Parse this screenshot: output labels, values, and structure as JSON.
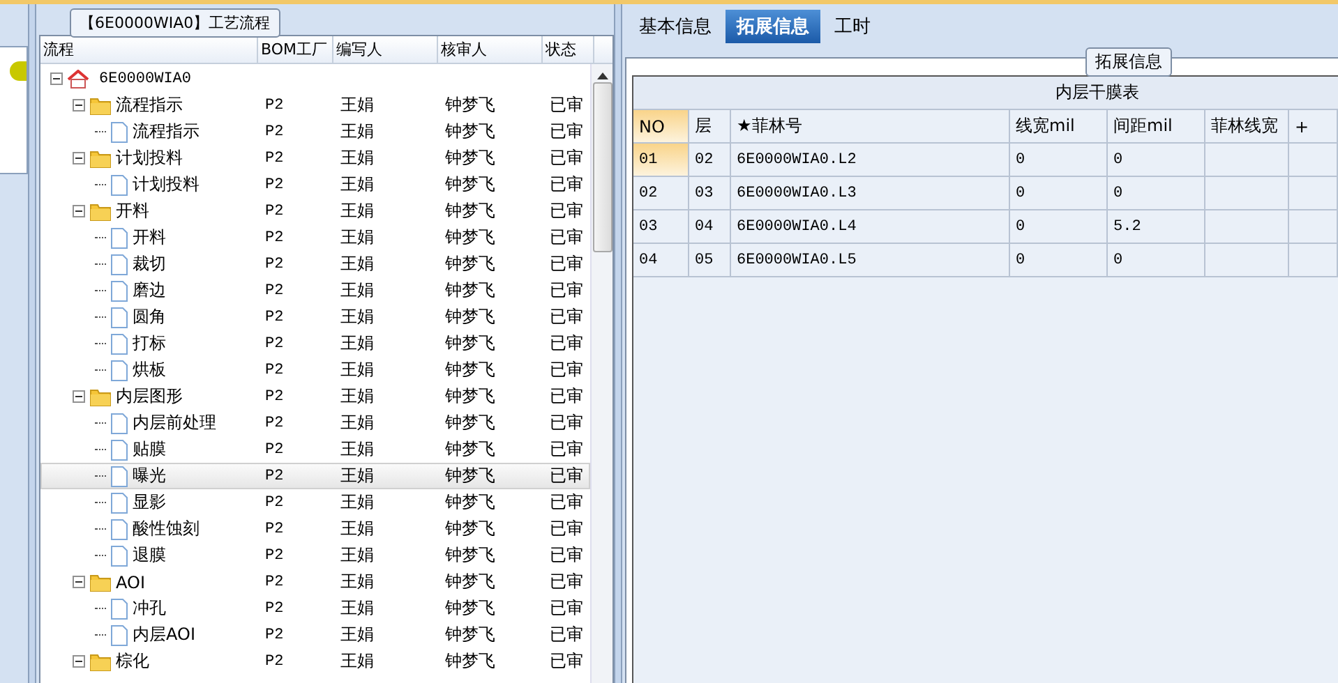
{
  "flow_panel": {
    "title": "【6E0000WIA0】工艺流程",
    "columns": [
      "流程",
      "BOM工厂",
      "编写人",
      "核审人",
      "状态"
    ],
    "tree": [
      {
        "kind": "root",
        "name": "6E0000WIA0",
        "selected": false,
        "expanded": true,
        "children": [
          {
            "kind": "folder",
            "name": "流程指示",
            "factory": "P2",
            "author": "王娟",
            "reviewer": "钟梦飞",
            "status": "已审",
            "selected": false,
            "expanded": true,
            "children": [
              {
                "kind": "doc",
                "name": "流程指示",
                "factory": "P2",
                "author": "王娟",
                "reviewer": "钟梦飞",
                "status": "已审",
                "selected": false
              }
            ]
          },
          {
            "kind": "folder",
            "name": "计划投料",
            "factory": "P2",
            "author": "王娟",
            "reviewer": "钟梦飞",
            "status": "已审",
            "selected": false,
            "expanded": true,
            "children": [
              {
                "kind": "doc",
                "name": "计划投料",
                "factory": "P2",
                "author": "王娟",
                "reviewer": "钟梦飞",
                "status": "已审",
                "selected": false
              }
            ]
          },
          {
            "kind": "folder",
            "name": "开料",
            "factory": "P2",
            "author": "王娟",
            "reviewer": "钟梦飞",
            "status": "已审",
            "selected": false,
            "expanded": true,
            "children": [
              {
                "kind": "doc",
                "name": "开料",
                "factory": "P2",
                "author": "王娟",
                "reviewer": "钟梦飞",
                "status": "已审",
                "selected": false
              },
              {
                "kind": "doc",
                "name": "裁切",
                "factory": "P2",
                "author": "王娟",
                "reviewer": "钟梦飞",
                "status": "已审",
                "selected": false
              },
              {
                "kind": "doc",
                "name": "磨边",
                "factory": "P2",
                "author": "王娟",
                "reviewer": "钟梦飞",
                "status": "已审",
                "selected": false
              },
              {
                "kind": "doc",
                "name": "圆角",
                "factory": "P2",
                "author": "王娟",
                "reviewer": "钟梦飞",
                "status": "已审",
                "selected": false
              },
              {
                "kind": "doc",
                "name": "打标",
                "factory": "P2",
                "author": "王娟",
                "reviewer": "钟梦飞",
                "status": "已审",
                "selected": false
              },
              {
                "kind": "doc",
                "name": "烘板",
                "factory": "P2",
                "author": "王娟",
                "reviewer": "钟梦飞",
                "status": "已审",
                "selected": false
              }
            ]
          },
          {
            "kind": "folder",
            "name": "内层图形",
            "factory": "P2",
            "author": "王娟",
            "reviewer": "钟梦飞",
            "status": "已审",
            "selected": false,
            "expanded": true,
            "children": [
              {
                "kind": "doc",
                "name": "内层前处理",
                "factory": "P2",
                "author": "王娟",
                "reviewer": "钟梦飞",
                "status": "已审",
                "selected": false
              },
              {
                "kind": "doc",
                "name": "贴膜",
                "factory": "P2",
                "author": "王娟",
                "reviewer": "钟梦飞",
                "status": "已审",
                "selected": false
              },
              {
                "kind": "doc",
                "name": "曝光",
                "factory": "P2",
                "author": "王娟",
                "reviewer": "钟梦飞",
                "status": "已审",
                "selected": true
              },
              {
                "kind": "doc",
                "name": "显影",
                "factory": "P2",
                "author": "王娟",
                "reviewer": "钟梦飞",
                "status": "已审",
                "selected": false
              },
              {
                "kind": "doc",
                "name": "酸性蚀刻",
                "factory": "P2",
                "author": "王娟",
                "reviewer": "钟梦飞",
                "status": "已审",
                "selected": false
              },
              {
                "kind": "doc",
                "name": "退膜",
                "factory": "P2",
                "author": "王娟",
                "reviewer": "钟梦飞",
                "status": "已审",
                "selected": false
              }
            ]
          },
          {
            "kind": "folder",
            "name": "AOI",
            "factory": "P2",
            "author": "王娟",
            "reviewer": "钟梦飞",
            "status": "已审",
            "selected": false,
            "expanded": true,
            "children": [
              {
                "kind": "doc",
                "name": "冲孔",
                "factory": "P2",
                "author": "王娟",
                "reviewer": "钟梦飞",
                "status": "已审",
                "selected": false
              },
              {
                "kind": "doc",
                "name": "内层AOI",
                "factory": "P2",
                "author": "王娟",
                "reviewer": "钟梦飞",
                "status": "已审",
                "selected": false
              }
            ]
          },
          {
            "kind": "folder",
            "name": "棕化",
            "factory": "P2",
            "author": "王娟",
            "reviewer": "钟梦飞",
            "status": "已审",
            "selected": false,
            "expanded": true
          }
        ]
      }
    ]
  },
  "tabs": [
    {
      "label": "基本信息",
      "selected": false
    },
    {
      "label": "拓展信息",
      "selected": true
    },
    {
      "label": "工时",
      "selected": false
    }
  ],
  "ext_panel": {
    "title": "拓展信息",
    "table": {
      "title": "内层干膜表",
      "columns": [
        "NO",
        "层",
        "★菲林号",
        "线宽mil",
        "间距mil",
        "菲林线宽",
        "+"
      ],
      "rows": [
        {
          "selected": true,
          "cells": [
            "01",
            "02",
            "6E0000WIA0.L2",
            "0",
            "0",
            ""
          ]
        },
        {
          "selected": false,
          "cells": [
            "02",
            "03",
            "6E0000WIA0.L3",
            "0",
            "0",
            ""
          ]
        },
        {
          "selected": false,
          "cells": [
            "03",
            "04",
            "6E0000WIA0.L4",
            "0",
            "5.2",
            ""
          ]
        },
        {
          "selected": false,
          "cells": [
            "04",
            "05",
            "6E0000WIA0.L5",
            "0",
            "0",
            ""
          ]
        }
      ]
    }
  }
}
